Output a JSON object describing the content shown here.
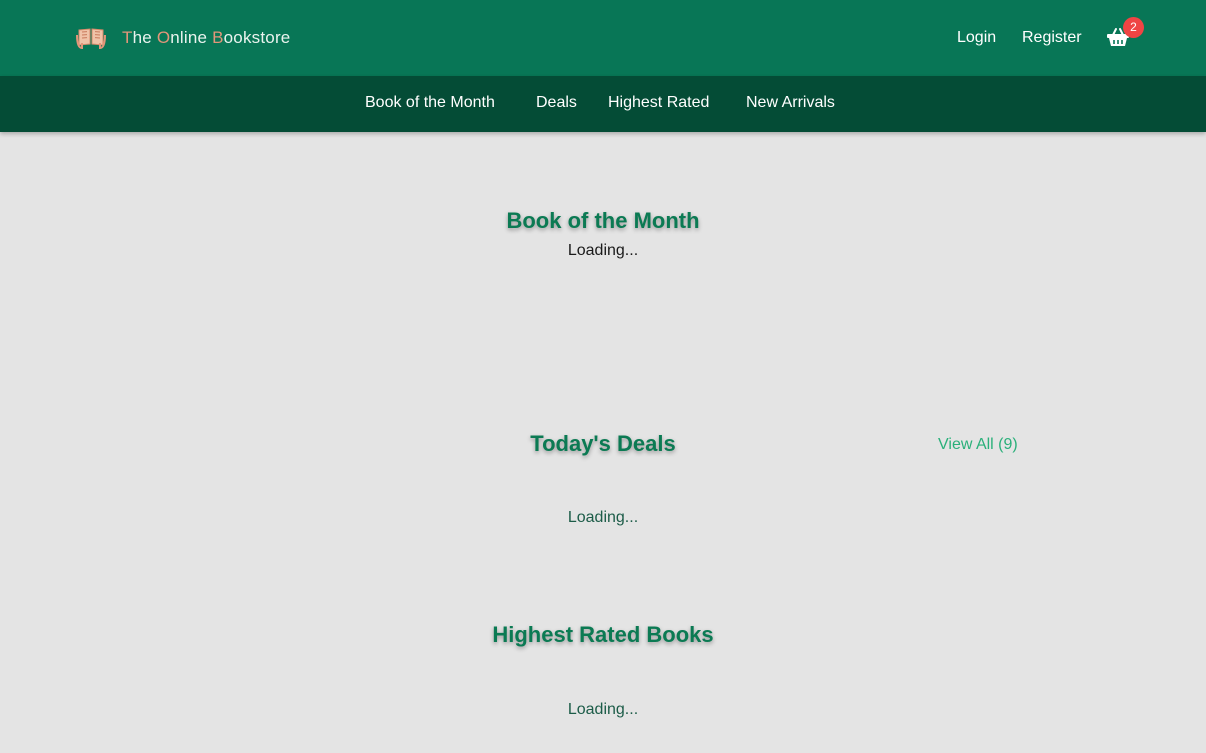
{
  "header": {
    "brand": {
      "icon": "open-book-icon",
      "parts": [
        {
          "text": "T",
          "highlight": true
        },
        {
          "text": "he ",
          "highlight": false
        },
        {
          "text": "O",
          "highlight": true
        },
        {
          "text": "nline ",
          "highlight": false
        },
        {
          "text": "B",
          "highlight": true
        },
        {
          "text": "ookstore",
          "highlight": false
        }
      ]
    },
    "login_label": "Login",
    "register_label": "Register",
    "cart": {
      "icon": "shopping-basket-icon",
      "count": "2"
    }
  },
  "nav": {
    "items": [
      {
        "label": "Book of the Month"
      },
      {
        "label": "Deals"
      },
      {
        "label": "Highest Rated"
      },
      {
        "label": "New Arrivals"
      }
    ]
  },
  "sections": {
    "book_of_month": {
      "title": "Book of the Month",
      "status": "Loading..."
    },
    "deals": {
      "title": "Today's Deals",
      "view_all": "View All (9)",
      "status": "Loading..."
    },
    "highest_rated": {
      "title": "Highest Rated Books",
      "status": "Loading..."
    }
  },
  "colors": {
    "header_bg": "#087656",
    "nav_bg": "#044c36",
    "page_bg": "#e4e4e4",
    "title_green": "#0b7a53",
    "brand_highlight": "#e2967a",
    "badge_red": "#ef4444",
    "link_green": "#2ab07a"
  }
}
